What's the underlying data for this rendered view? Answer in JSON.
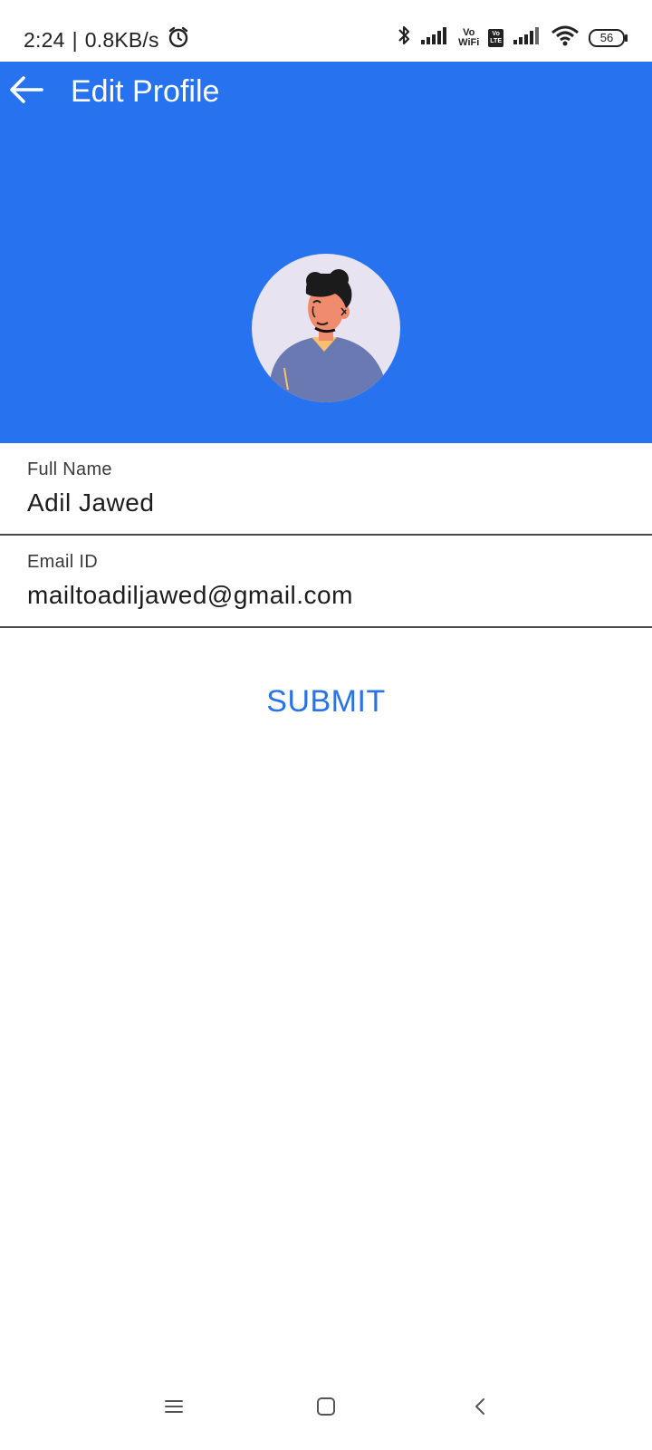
{
  "status_bar": {
    "time": "2:24",
    "separator": "|",
    "speed": "0.8KB/s",
    "vo_top": "Vo",
    "vo_bottom": "WiFi",
    "vo_lte": "Vo\nLTE",
    "battery": "56",
    "icons": [
      "alarm-icon",
      "bluetooth-icon",
      "signal-icon",
      "vowifi-icon",
      "volte-icon",
      "signal-icon",
      "wifi-icon",
      "battery-icon"
    ]
  },
  "header": {
    "title": "Edit Profile",
    "back_icon": "arrow-left-icon",
    "color": "#2772ef"
  },
  "form": {
    "full_name": {
      "label": "Full Name",
      "value": "Adil Jawed"
    },
    "email": {
      "label": "Email ID",
      "value": "mailtoadiljawed@gmail.com"
    },
    "submit_label": "SUBMIT"
  },
  "nav": {
    "icons": [
      "menu-icon",
      "home-icon",
      "back-icon"
    ]
  },
  "colors": {
    "accent": "#2772ef",
    "submit_text": "#2a73e6",
    "avatar_bg": "#e7e3f1"
  }
}
